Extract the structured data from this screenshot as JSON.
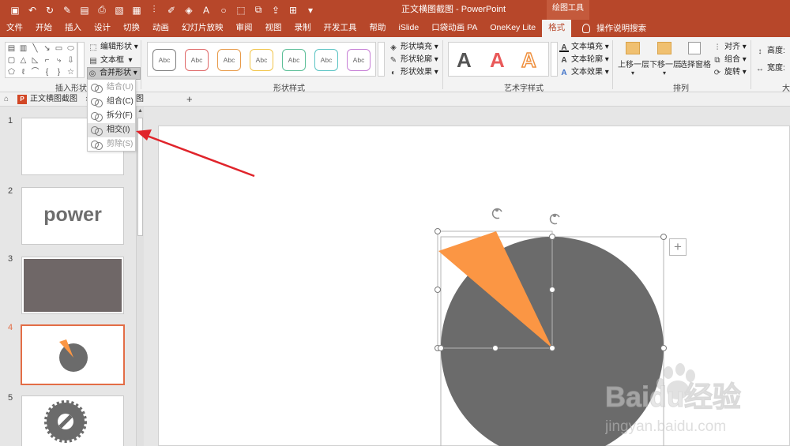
{
  "titlebar": {
    "title": "正文横图截图  -  PowerPoint",
    "contextual_tab_group": "绘图工具",
    "quick_access": [
      "save-icon",
      "undo-icon",
      "redo-icon",
      "format-painter-icon",
      "new-slide-icon",
      "print-preview-icon",
      "screenshot-icon",
      "table-icon",
      "align-icon",
      "eyedropper-icon",
      "fill-color-icon",
      "font-color-icon",
      "circle-icon",
      "select-icon",
      "group-icon",
      "bring-forward-icon",
      "distribute-icon",
      "more-icon"
    ]
  },
  "tabs": {
    "items": [
      "文件",
      "开始",
      "插入",
      "设计",
      "切换",
      "动画",
      "幻灯片放映",
      "审阅",
      "视图",
      "录制",
      "开发工具",
      "帮助",
      "iSlide",
      "口袋动画 PA",
      "OneKey Lite",
      "格式"
    ],
    "active": "格式",
    "tell_me": "操作说明搜索"
  },
  "ribbon": {
    "insert_shapes": {
      "label": "插入形状",
      "edit_shape": "编辑形状",
      "text_box": "文本框",
      "merge_shapes": "合并形状"
    },
    "shape_styles": {
      "label": "形状样式",
      "fill": "形状填充",
      "outline": "形状轮廓",
      "effects": "形状效果",
      "abc": "Abc",
      "swatch_colors": [
        "#7f7f7f",
        "#e06a6a",
        "#e89b4a",
        "#f2c54a",
        "#5cbf98",
        "#5cc4c4",
        "#c77fd6"
      ]
    },
    "wordart_styles": {
      "label": "艺术字样式",
      "text_fill": "文本填充",
      "text_outline": "文本轮廓",
      "text_effects": "文本效果",
      "letter": "A"
    },
    "arrange": {
      "label": "排列",
      "bring_forward": "上移一层",
      "send_backward": "下移一层",
      "selection_pane": "选择窗格",
      "align": "对齐",
      "group": "组合",
      "rotate": "旋转"
    },
    "size": {
      "height": "高度:",
      "width": "宽度:",
      "label_partial": "大"
    }
  },
  "merge_menu": {
    "items": [
      {
        "label": "结合(U)",
        "state": "disabled"
      },
      {
        "label": "组合(C)",
        "state": "normal"
      },
      {
        "label": "拆分(F)",
        "state": "normal"
      },
      {
        "label": "相交(I)",
        "state": "hover"
      },
      {
        "label": "剪除(S)",
        "state": "disabled"
      }
    ]
  },
  "document_tab": {
    "name": "正文横图截图",
    "close": "×",
    "partial_tab": "图",
    "add": "+"
  },
  "slides": {
    "numbers": [
      "1",
      "2",
      "3",
      "4",
      "5"
    ],
    "slide2_text": "power",
    "selected_index": 4
  },
  "canvas": {
    "add_button": "+",
    "circle_color": "#6b6b6b",
    "wedge_color": "#fb9644"
  },
  "colors": {
    "accent": "#b7472a",
    "selection_border": "#e36d46",
    "arrow": "#e0242b"
  },
  "watermark": {
    "brand": "Baidu经验",
    "url": "jingyan.baidu.com"
  }
}
